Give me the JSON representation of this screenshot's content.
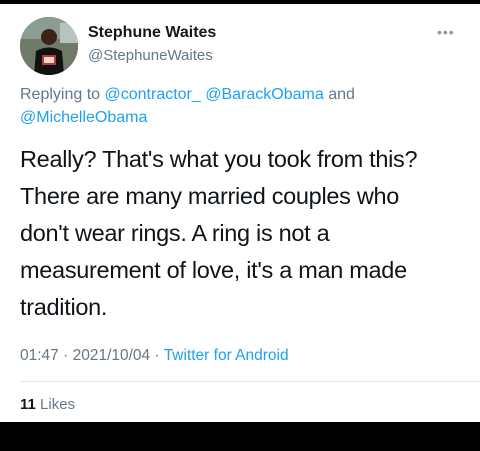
{
  "tweet": {
    "author": {
      "name": "Stephune Waites",
      "handle": "@StephuneWaites"
    },
    "reply": {
      "prefix": "Replying to",
      "mention1": "@contractor_",
      "mention2": "@BarackObama",
      "joiner": "and",
      "mention3": "@MichelleObama"
    },
    "text": "Really? That's what you took from this? There are many married couples who don't wear rings. A ring is not a measurement of love, it's a man made tradition.",
    "time": "01:47",
    "date": "2021/10/04",
    "source": "Twitter for Android",
    "likes": {
      "count": "11",
      "label": "Likes"
    }
  },
  "icons": {
    "more": "more-dots-icon",
    "avatar": "avatar-image"
  },
  "colors": {
    "link": "#1da1f2",
    "secondary": "#657786",
    "text": "#0f1419"
  }
}
